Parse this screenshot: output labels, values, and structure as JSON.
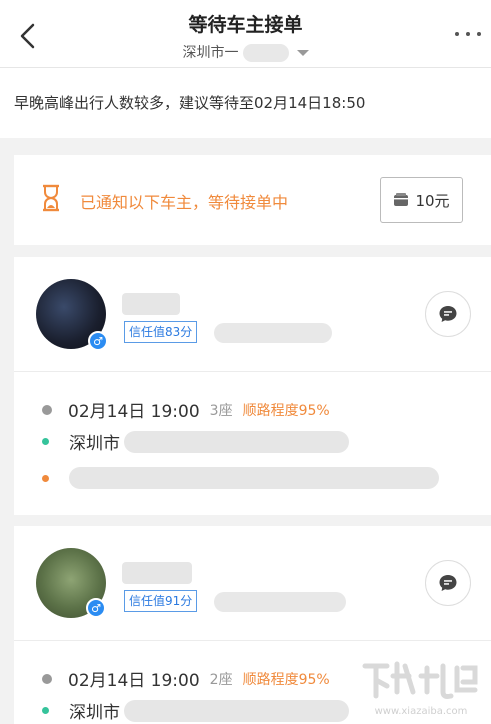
{
  "header": {
    "title": "等待车主接单",
    "subtitle_prefix": "深圳市一"
  },
  "notice": {
    "text": "早晚高峰出行人数较多，建议等待至02月14日18:50"
  },
  "status": {
    "text": "已通知以下车主，等待接单中",
    "price": "10元",
    "accent_color": "#f08a3c"
  },
  "drivers": [
    {
      "trust_label": "信任值83分",
      "time": "02月14日 19:00",
      "seats": "3座",
      "match": "顺路程度95%",
      "start_city": "深圳市"
    },
    {
      "trust_label": "信任值91分",
      "time": "02月14日 19:00",
      "seats": "2座",
      "match": "顺路程度95%",
      "start_city": "深圳市"
    }
  ]
}
